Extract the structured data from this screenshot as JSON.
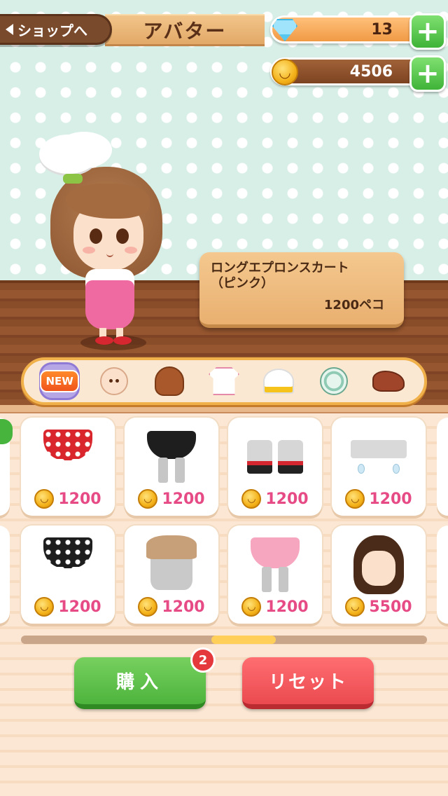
{
  "header": {
    "back_label": "ショップへ",
    "title": "アバター"
  },
  "currency": {
    "gems": "13",
    "coins": "4506",
    "coin_symbol": "◡",
    "plus": "+"
  },
  "selected_item": {
    "name_line1": "ロングエプロンスカート",
    "name_line2": "（ピンク）",
    "price": "1200ペコ"
  },
  "categories": {
    "new_label": "NEW",
    "icons": [
      "new-icon",
      "face-icon",
      "hair-icon",
      "clothes-icon",
      "hat-icon",
      "accessory-icon",
      "shoes-icon"
    ]
  },
  "items": [
    {
      "icon": "red-polka-skirt-icon",
      "price": "1200"
    },
    {
      "icon": "black-frill-skirt-icon",
      "price": "1200"
    },
    {
      "icon": "white-boots-icon",
      "price": "1200"
    },
    {
      "icon": "drop-earrings-icon",
      "price": "1200"
    },
    {
      "icon": "black-polka-skirt-icon",
      "price": "1200"
    },
    {
      "icon": "brown-hat-icon",
      "price": "1200"
    },
    {
      "icon": "pink-tutu-skirt-icon",
      "price": "1200"
    },
    {
      "icon": "brown-bob-hair-icon",
      "price": "5500"
    }
  ],
  "scroll": {
    "position": 0.5
  },
  "actions": {
    "buy_label": "購入",
    "buy_count": "2",
    "reset_label": "リセット"
  },
  "colors": {
    "price_pink": "#e64b86",
    "buy_green": "#4db43c",
    "reset_red": "#ea4a50",
    "badge_red": "#e5383d"
  }
}
